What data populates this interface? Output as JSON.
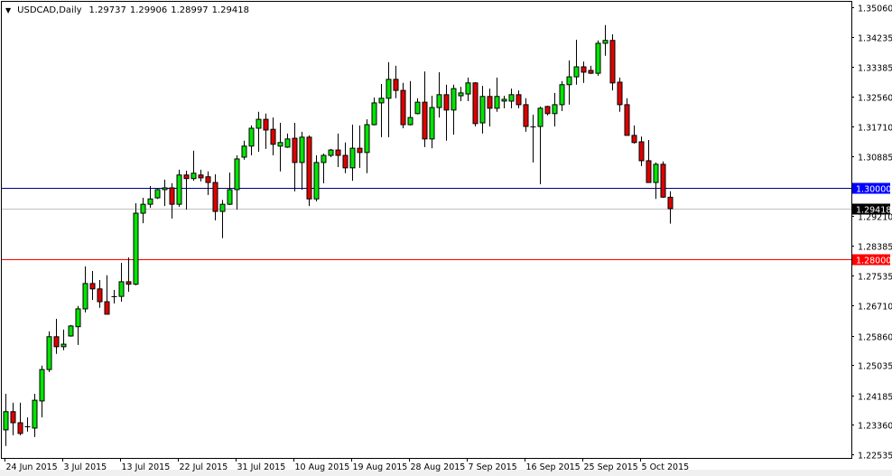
{
  "header": {
    "menu_icon": "triangle-down-icon",
    "symbol_timeframe": "USDCAD,Daily",
    "open": "1.29737",
    "high": "1.29906",
    "low": "1.28997",
    "close": "1.29418"
  },
  "colors": {
    "bull": "#00e600",
    "bear": "#e00000",
    "outline": "#000000",
    "line_1_30": "#000080",
    "line_1_28": "#ff0000",
    "bid_line": "#c0c0c0",
    "label_1_30_bg": "#0000ff",
    "label_1_28_bg": "#ff0000",
    "label_bid_bg": "#000000"
  },
  "chart_data": {
    "type": "candlestick",
    "title": "USDCAD,Daily",
    "xlabel": "",
    "ylabel": "",
    "ylim": [
      1.22535,
      1.3506
    ],
    "grid": false,
    "y_ticks": [
      "1.35060",
      "1.34235",
      "1.33385",
      "1.32560",
      "1.31710",
      "1.30885",
      "1.29210",
      "1.28385",
      "1.27535",
      "1.26710",
      "1.25860",
      "1.25035",
      "1.24185",
      "1.23360",
      "1.22535"
    ],
    "x_ticks": [
      {
        "label": "24 Jun 2015",
        "index": 0
      },
      {
        "label": "3 Jul 2015",
        "index": 8
      },
      {
        "label": "13 Jul 2015",
        "index": 16
      },
      {
        "label": "22 Jul 2015",
        "index": 24
      },
      {
        "label": "31 Jul 2015",
        "index": 32
      },
      {
        "label": "10 Aug 2015",
        "index": 40
      },
      {
        "label": "19 Aug 2015",
        "index": 48
      },
      {
        "label": "28 Aug 2015",
        "index": 56
      },
      {
        "label": "7 Sep 2015",
        "index": 64
      },
      {
        "label": "16 Sep 2015",
        "index": 72
      },
      {
        "label": "25 Sep 2015",
        "index": 80
      },
      {
        "label": "5 Oct 2015",
        "index": 88
      }
    ],
    "hlines": [
      {
        "value": 1.3,
        "label": "1.30000",
        "kind": "level-blue"
      },
      {
        "value": 1.29418,
        "label": "1.29418",
        "kind": "bid"
      },
      {
        "value": 1.28,
        "label": "1.28000",
        "kind": "level-red"
      }
    ],
    "ohlc_fields": [
      "open",
      "high",
      "low",
      "close"
    ],
    "ohlc": [
      [
        1.2322,
        1.2423,
        1.2277,
        1.2373
      ],
      [
        1.2373,
        1.2398,
        1.2307,
        1.2342
      ],
      [
        1.2342,
        1.2398,
        1.2307,
        1.2312
      ],
      [
        1.2332,
        1.2357,
        1.2317,
        1.2333
      ],
      [
        1.2327,
        1.2423,
        1.2302,
        1.2405
      ],
      [
        1.2403,
        1.2502,
        1.2357,
        1.2491
      ],
      [
        1.2491,
        1.2598,
        1.2484,
        1.2583
      ],
      [
        1.2583,
        1.2633,
        1.2535,
        1.2555
      ],
      [
        1.2555,
        1.2603,
        1.2545,
        1.2562
      ],
      [
        1.2585,
        1.2616,
        1.2583,
        1.2613
      ],
      [
        1.2611,
        1.2669,
        1.256,
        1.2661
      ],
      [
        1.2661,
        1.278,
        1.2651,
        1.2732
      ],
      [
        1.2732,
        1.2767,
        1.2686,
        1.2717
      ],
      [
        1.2717,
        1.2742,
        1.2664,
        1.2681
      ],
      [
        1.2681,
        1.2755,
        1.2646,
        1.2646
      ],
      [
        1.2696,
        1.2714,
        1.2676,
        1.2697
      ],
      [
        1.2696,
        1.279,
        1.2681,
        1.2737
      ],
      [
        1.2737,
        1.2805,
        1.2709,
        1.273
      ],
      [
        1.273,
        1.2957,
        1.2727,
        1.2929
      ],
      [
        1.2929,
        1.2972,
        1.2901,
        1.2954
      ],
      [
        1.2954,
        1.3005,
        1.2944,
        1.2969
      ],
      [
        1.2972,
        1.2997,
        1.2969,
        1.2995
      ],
      [
        1.2995,
        1.3023,
        1.2949,
        1.3
      ],
      [
        1.3,
        1.3013,
        1.2914,
        1.2954
      ],
      [
        1.2954,
        1.3051,
        1.2947,
        1.3036
      ],
      [
        1.3036,
        1.3048,
        1.2939,
        1.3026
      ],
      [
        1.3026,
        1.3104,
        1.302,
        1.3041
      ],
      [
        1.3036,
        1.3051,
        1.3018,
        1.3028
      ],
      [
        1.3031,
        1.3046,
        1.298,
        1.3015
      ],
      [
        1.3015,
        1.3038,
        1.2909,
        1.2934
      ],
      [
        1.2934,
        1.2966,
        1.2859,
        1.2954
      ],
      [
        1.2954,
        1.3043,
        1.2952,
        1.2995
      ],
      [
        1.2995,
        1.3091,
        1.2939,
        1.3081
      ],
      [
        1.3086,
        1.3132,
        1.3079,
        1.3117
      ],
      [
        1.3117,
        1.3175,
        1.3091,
        1.3167
      ],
      [
        1.3167,
        1.3213,
        1.3101,
        1.3192
      ],
      [
        1.3192,
        1.3208,
        1.3109,
        1.3162
      ],
      [
        1.3164,
        1.3197,
        1.3091,
        1.3122
      ],
      [
        1.3117,
        1.3182,
        1.3046,
        1.3127
      ],
      [
        1.3114,
        1.3152,
        1.3112,
        1.3137
      ],
      [
        1.3139,
        1.3182,
        1.299,
        1.3071
      ],
      [
        1.3071,
        1.3157,
        1.2995,
        1.3142
      ],
      [
        1.3142,
        1.3147,
        1.2949,
        1.2969
      ],
      [
        1.2969,
        1.3091,
        1.2962,
        1.3071
      ],
      [
        1.3071,
        1.3096,
        1.3013,
        1.3091
      ],
      [
        1.3091,
        1.3109,
        1.3086,
        1.3106
      ],
      [
        1.3106,
        1.3152,
        1.3058,
        1.3091
      ],
      [
        1.3091,
        1.3127,
        1.3041,
        1.3056
      ],
      [
        1.3056,
        1.3177,
        1.302,
        1.3111
      ],
      [
        1.3111,
        1.3175,
        1.3056,
        1.3099
      ],
      [
        1.3099,
        1.3192,
        1.3041,
        1.3177
      ],
      [
        1.3177,
        1.3253,
        1.3175,
        1.3238
      ],
      [
        1.3238,
        1.3291,
        1.3142,
        1.3251
      ],
      [
        1.3251,
        1.3352,
        1.3142,
        1.3304
      ],
      [
        1.3304,
        1.3342,
        1.3251,
        1.3273
      ],
      [
        1.3273,
        1.3294,
        1.3167,
        1.3177
      ],
      [
        1.3177,
        1.3299,
        1.3175,
        1.3197
      ],
      [
        1.3208,
        1.3251,
        1.3206,
        1.324
      ],
      [
        1.324,
        1.3326,
        1.3114,
        1.3137
      ],
      [
        1.3137,
        1.3258,
        1.3111,
        1.3225
      ],
      [
        1.3225,
        1.3324,
        1.3197,
        1.3261
      ],
      [
        1.3261,
        1.3289,
        1.3132,
        1.3218
      ],
      [
        1.3218,
        1.3289,
        1.3149,
        1.3278
      ],
      [
        1.3258,
        1.3283,
        1.3243,
        1.3266
      ],
      [
        1.3263,
        1.3309,
        1.3243,
        1.3294
      ],
      [
        1.3294,
        1.3296,
        1.3172,
        1.318
      ],
      [
        1.3182,
        1.3286,
        1.3152,
        1.3256
      ],
      [
        1.3256,
        1.3278,
        1.3172,
        1.3223
      ],
      [
        1.3223,
        1.3309,
        1.3213,
        1.3256
      ],
      [
        1.3243,
        1.3258,
        1.3223,
        1.3248
      ],
      [
        1.3243,
        1.3278,
        1.3223,
        1.3261
      ],
      [
        1.3261,
        1.3273,
        1.3223,
        1.3233
      ],
      [
        1.3233,
        1.3251,
        1.3157,
        1.3172
      ],
      [
        1.3172,
        1.3205,
        1.3071,
        1.3171
      ],
      [
        1.3172,
        1.3228,
        1.301,
        1.3223
      ],
      [
        1.3228,
        1.323,
        1.3203,
        1.3208
      ],
      [
        1.3208,
        1.3266,
        1.3172,
        1.3233
      ],
      [
        1.3233,
        1.3299,
        1.3215,
        1.3289
      ],
      [
        1.3289,
        1.3357,
        1.3233,
        1.3311
      ],
      [
        1.3311,
        1.3415,
        1.3289,
        1.3339
      ],
      [
        1.3339,
        1.3354,
        1.3294,
        1.3324
      ],
      [
        1.3329,
        1.3342,
        1.3319,
        1.3321
      ],
      [
        1.3321,
        1.3413,
        1.3314,
        1.3405
      ],
      [
        1.3405,
        1.3456,
        1.337,
        1.3413
      ],
      [
        1.3413,
        1.343,
        1.3273,
        1.3294
      ],
      [
        1.3296,
        1.3309,
        1.3213,
        1.3233
      ],
      [
        1.3233,
        1.3251,
        1.3147,
        1.3147
      ],
      [
        1.3147,
        1.3175,
        1.3124,
        1.3127
      ],
      [
        1.3129,
        1.3144,
        1.3061,
        1.3076
      ],
      [
        1.3076,
        1.3134,
        1.3015,
        1.3015
      ],
      [
        1.3015,
        1.3071,
        1.2969,
        1.3066
      ],
      [
        1.3066,
        1.3074,
        1.2972,
        1.2974
      ],
      [
        1.29737,
        1.29906,
        1.28997,
        1.29418
      ]
    ]
  }
}
